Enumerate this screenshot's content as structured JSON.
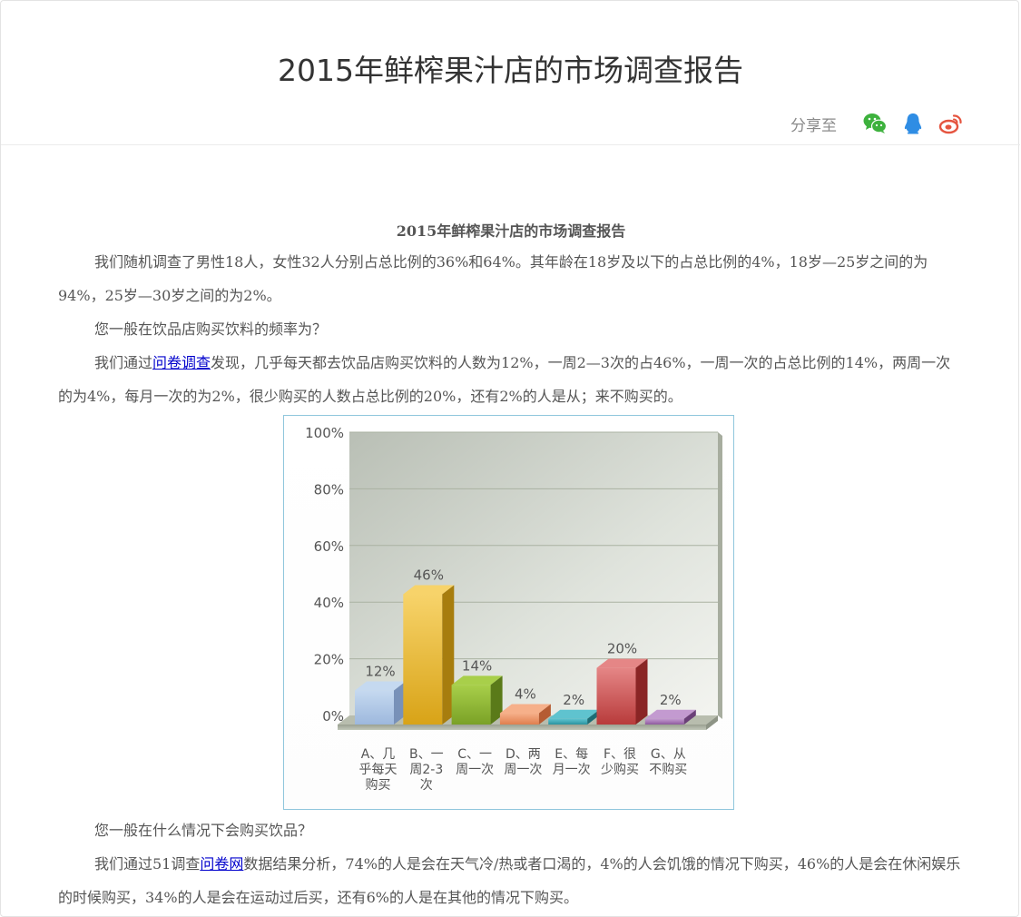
{
  "page": {
    "title": "2015年鲜榨果汁店的市场调查报告",
    "share_label": "分享至",
    "share_icons": [
      "wechat-icon",
      "qq-icon",
      "weibo-icon"
    ],
    "colors": {
      "wechat": "#3db13d",
      "qq": "#2f8de4",
      "weibo": "#e5543f"
    }
  },
  "article": {
    "title": "2015年鲜榨果汁店的市场调查报告",
    "p1": "我们随机调查了男性18人，女性32人分别占总比例的36%和64%。其年龄在18岁及以下的占总比例的4%，18岁—25岁之间的为94%，25岁—30岁之间的为2%。",
    "q1": "您一般在饮品店购买饮料的频率为？",
    "p2_pre": "我们通过",
    "p2_link": "问卷调查",
    "p2_post": "发现，几乎每天都去饮品店购买饮料的人数为12%，一周2—3次的占46%，一周一次的占总比例的14%，两周一次的为4%，每月一次的为2%，很少购买的人数占总比例的20%，还有2%的人是从；来不购买的。",
    "q2": "您一般在什么情况下会购买饮品？",
    "p3_pre": "我们通过51调查",
    "p3_link": "问卷网",
    "p3_post": "数据结果分析，74%的人是会在天气冷/热或者口渴的，4%的人会饥饿的情况下购买，46%的人是会在休闲娱乐的时候购买，34%的人是会在运动过后买，还有6%的人是在其他的情况下购买。"
  },
  "chart_data": {
    "type": "bar",
    "categories": [
      [
        "A、几",
        "乎每天",
        "购买"
      ],
      [
        "B、一",
        "周2-3",
        "次"
      ],
      [
        "C、一",
        "周一次"
      ],
      [
        "D、两",
        "周一次"
      ],
      [
        "E、每",
        "月一次"
      ],
      [
        "F、很",
        "少购买"
      ],
      [
        "G、从",
        "不购买"
      ]
    ],
    "values": [
      12,
      46,
      14,
      4,
      2,
      20,
      2
    ],
    "value_labels": [
      "12%",
      "46%",
      "14%",
      "4%",
      "2%",
      "20%",
      "2%"
    ],
    "y_ticks": [
      "0%",
      "20%",
      "40%",
      "60%",
      "80%",
      "100%"
    ],
    "ylim": [
      0,
      100
    ],
    "grid": true,
    "bar_colors": [
      [
        "#c5d9f0",
        "#9db8dd",
        "#7891b8"
      ],
      [
        "#f7d36a",
        "#d8a317",
        "#a77d0e"
      ],
      [
        "#a8cf4a",
        "#7aa126",
        "#5a7a19"
      ],
      [
        "#f6b08a",
        "#e07f4e",
        "#b55c33"
      ],
      [
        "#5fc3cf",
        "#2a939f",
        "#1d6c75"
      ],
      [
        "#e58686",
        "#b83b3b",
        "#8a2525"
      ],
      [
        "#c39ad0",
        "#8e5a9e",
        "#6a3f78"
      ]
    ]
  }
}
